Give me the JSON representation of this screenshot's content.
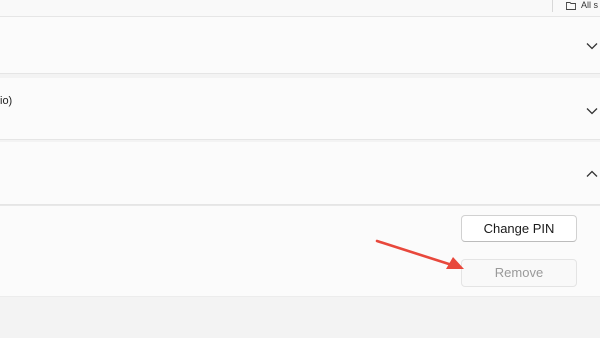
{
  "topbar": {
    "label": "All s",
    "icon": "folder-icon"
  },
  "sections": [
    {
      "label": "",
      "icon": "chevron-down-icon",
      "expanded": false
    },
    {
      "label": "io)",
      "icon": "chevron-down-icon",
      "expanded": false
    },
    {
      "label": "",
      "icon": "chevron-up-icon",
      "expanded": true
    }
  ],
  "pin": {
    "change_label": "Change PIN",
    "remove_label": "Remove"
  },
  "annotation": {
    "arrow_color": "#e8483c",
    "points_to": "remove-button"
  },
  "colors": {
    "background": "#f3f3f3",
    "card": "#fbfbfb",
    "disabled_text": "#9a9a9a",
    "accent_arrow": "#e8483c"
  }
}
